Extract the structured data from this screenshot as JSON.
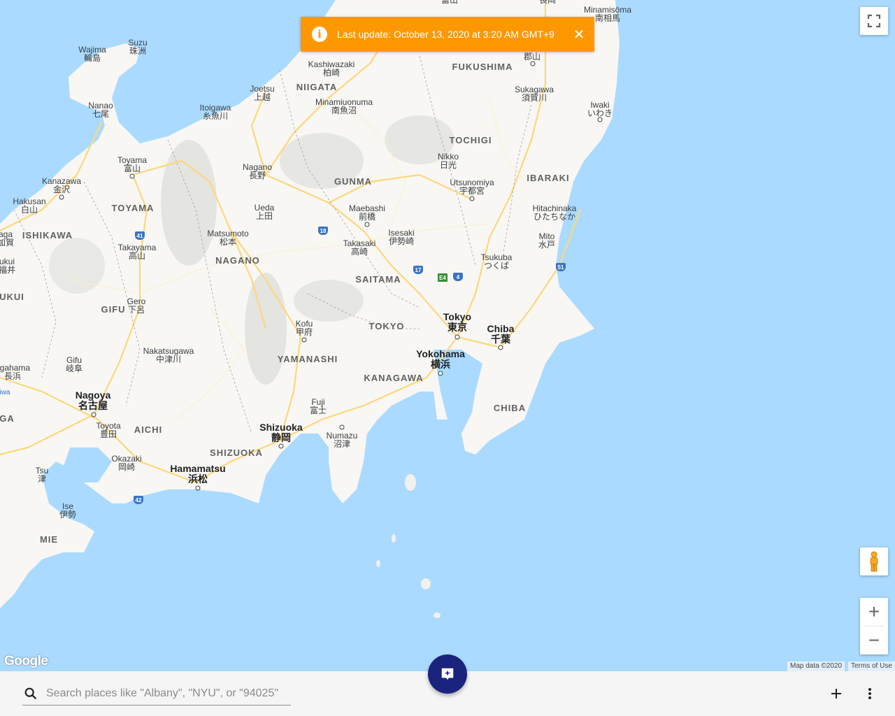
{
  "banner": {
    "text": "Last update: October 13, 2020 at 3:20 AM GMT+9",
    "info_icon": "info-icon",
    "close_icon": "close-icon",
    "color": "#ff9800"
  },
  "map": {
    "water_color": "#aadaff",
    "land_color": "#f8f7f4",
    "prefectures": [
      "FUKUSHIMA",
      "NIIGATA",
      "TOCHIGI",
      "IBARAKI",
      "GUNMA",
      "TOYAMA",
      "ISHIKAWA",
      "NAGANO",
      "SAITAMA",
      "GIFU",
      "TOKYO",
      "YAMANASHI",
      "KANAGAWA",
      "CHIBA",
      "AICHI",
      "SHIZUOKA",
      "MIE",
      "UKUI",
      "GA"
    ],
    "cities": [
      {
        "en": "Minamisōma",
        "jp": "南相馬"
      },
      {
        "en": "",
        "jp": "郡山"
      },
      {
        "en": "Sukagawa",
        "jp": "須賀川"
      },
      {
        "en": "Iwaki",
        "jp": "いわき"
      },
      {
        "en": "Kashiwazaki",
        "jp": "柏崎"
      },
      {
        "en": "Joetsu",
        "jp": "上越"
      },
      {
        "en": "Minamiuonuma",
        "jp": "南魚沼"
      },
      {
        "en": "Itoigawa",
        "jp": "糸魚川"
      },
      {
        "en": "Wajima",
        "jp": "輪島"
      },
      {
        "en": "Suzu",
        "jp": "珠洲"
      },
      {
        "en": "Nanao",
        "jp": "七尾"
      },
      {
        "en": "Toyama",
        "jp": "富山"
      },
      {
        "en": "Kanazawa",
        "jp": "金沢"
      },
      {
        "en": "Hakusan",
        "jp": "白山"
      },
      {
        "en": "Nagano",
        "jp": "長野"
      },
      {
        "en": "Ueda",
        "jp": "上田"
      },
      {
        "en": "Nikko",
        "jp": "日光"
      },
      {
        "en": "Utsunomiya",
        "jp": "宇都宮"
      },
      {
        "en": "Maebashi",
        "jp": "前橋"
      },
      {
        "en": "Isesaki",
        "jp": "伊勢崎"
      },
      {
        "en": "Takasaki",
        "jp": "高崎"
      },
      {
        "en": "Hitachinaka",
        "jp": "ひたちなか"
      },
      {
        "en": "Mito",
        "jp": "水戸"
      },
      {
        "en": "Tsukuba",
        "jp": "つくば"
      },
      {
        "en": "Matsumoto",
        "jp": "松本"
      },
      {
        "en": "Takayama",
        "jp": "高山"
      },
      {
        "en": "Gero",
        "jp": "下呂"
      },
      {
        "en": "Kofu",
        "jp": "甲府"
      },
      {
        "en": "Nakatsugawa",
        "jp": "中津川"
      },
      {
        "en": "Gifu",
        "jp": "岐阜"
      },
      {
        "en": "Fuji",
        "jp": "富士"
      },
      {
        "en": "Numazu",
        "jp": "沼津"
      },
      {
        "en": "Toyota",
        "jp": "豊田"
      },
      {
        "en": "Okazaki",
        "jp": "岡崎"
      },
      {
        "en": "Tsu",
        "jp": "津"
      },
      {
        "en": "Ise",
        "jp": "伊勢"
      },
      {
        "en": "agahama",
        "jp": "長浜"
      },
      {
        "en": "aga",
        "jp": "加賀"
      },
      {
        "en": "ukui",
        "jp": "福井"
      },
      {
        "en": "iwa",
        "jp": ""
      }
    ],
    "major_cities": [
      {
        "en": "Tokyo",
        "jp": "東京"
      },
      {
        "en": "Chiba",
        "jp": "千葉"
      },
      {
        "en": "Yokohama",
        "jp": "横浜"
      },
      {
        "en": "Nagoya",
        "jp": "名古屋"
      },
      {
        "en": "Shizuoka",
        "jp": "静岡"
      },
      {
        "en": "Hamamatsu",
        "jp": "浜松"
      }
    ],
    "route_shields": [
      "41",
      "18",
      "17",
      "4",
      "E4",
      "51",
      "42"
    ],
    "top_cut_labels": [
      "富山",
      "長岡",
      "",
      "Minamisōma"
    ]
  },
  "controls": {
    "fullscreen_icon": "fullscreen-icon",
    "pegman_icon": "pegman-icon",
    "zoom_in": "+",
    "zoom_out": "−"
  },
  "attribution": {
    "logo": "Google",
    "map_data": "Map data ©2020",
    "terms": "Terms of Use"
  },
  "bottom_bar": {
    "search_placeholder": "Search places like \"Albany\", \"NYU\", or \"94025\"",
    "search_icon": "search-icon",
    "fab_icon": "add-report-icon",
    "add_icon": "plus-icon",
    "more_icon": "more-vert-icon"
  }
}
